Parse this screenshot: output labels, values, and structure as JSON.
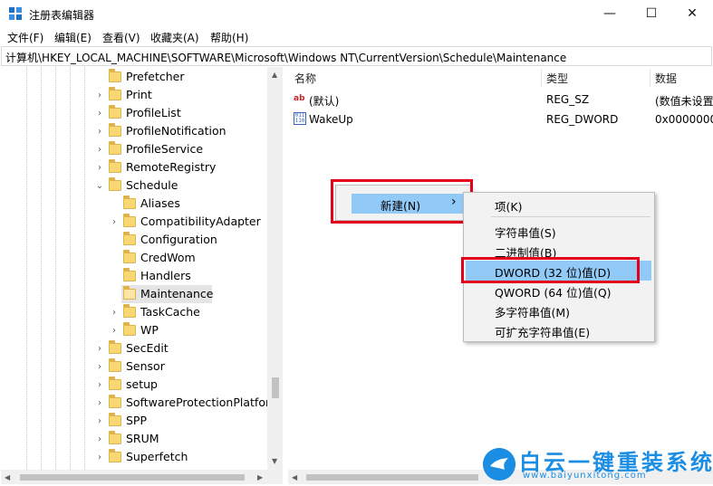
{
  "window": {
    "title": "注册表编辑器",
    "minimize": "—",
    "maximize": "☐",
    "close": "✕"
  },
  "menu": [
    {
      "label": "文件(F)"
    },
    {
      "label": "编辑(E)"
    },
    {
      "label": "查看(V)"
    },
    {
      "label": "收藏夹(A)"
    },
    {
      "label": "帮助(H)"
    }
  ],
  "address": "计算机\\HKEY_LOCAL_MACHINE\\SOFTWARE\\Microsoft\\Windows NT\\CurrentVersion\\Schedule\\Maintenance",
  "tree": {
    "items": [
      {
        "label": "Prefetcher",
        "expander": "",
        "selected": false
      },
      {
        "label": "Print",
        "expander": "›",
        "selected": false
      },
      {
        "label": "ProfileList",
        "expander": "›",
        "selected": false
      },
      {
        "label": "ProfileNotification",
        "expander": "›",
        "selected": false
      },
      {
        "label": "ProfileService",
        "expander": "›",
        "selected": false
      },
      {
        "label": "RemoteRegistry",
        "expander": "›",
        "selected": false
      },
      {
        "label": "Schedule",
        "expander": "⌄",
        "selected": false
      },
      {
        "label": "Aliases",
        "expander": "",
        "selected": false
      },
      {
        "label": "CompatibilityAdapter",
        "expander": "›",
        "selected": false
      },
      {
        "label": "Configuration",
        "expander": "",
        "selected": false
      },
      {
        "label": "CredWom",
        "expander": "",
        "selected": false
      },
      {
        "label": "Handlers",
        "expander": "",
        "selected": false
      },
      {
        "label": "Maintenance",
        "expander": "",
        "selected": true
      },
      {
        "label": "TaskCache",
        "expander": "›",
        "selected": false
      },
      {
        "label": "WP",
        "expander": "›",
        "selected": false
      },
      {
        "label": "SecEdit",
        "expander": "›",
        "selected": false
      },
      {
        "label": "Sensor",
        "expander": "›",
        "selected": false
      },
      {
        "label": "setup",
        "expander": "›",
        "selected": false
      },
      {
        "label": "SoftwareProtectionPlatform",
        "expander": "›",
        "selected": false
      },
      {
        "label": "SPP",
        "expander": "›",
        "selected": false
      },
      {
        "label": "SRUM",
        "expander": "›",
        "selected": false
      },
      {
        "label": "Superfetch",
        "expander": "›",
        "selected": false
      }
    ]
  },
  "list": {
    "columns": {
      "name": "名称",
      "type": "类型",
      "data": "数据"
    },
    "rows": [
      {
        "icon": "string-value-icon",
        "icon_text": "ab",
        "name": "(默认)",
        "type": "REG_SZ",
        "data": "(数值未设置"
      },
      {
        "icon": "binary-value-icon",
        "icon_text": "011 110",
        "name": "WakeUp",
        "type": "REG_DWORD",
        "data": "0x0000000"
      }
    ]
  },
  "context_menu": {
    "new_item": "新建(N)",
    "new_arrow": "›",
    "submenu": {
      "key": "项(K)",
      "string": "字符串值(S)",
      "binary": "二进制值(B)",
      "dword": "DWORD (32 位)值(D)",
      "qword": "QWORD (64 位)值(Q)",
      "multi": "多字符串值(M)",
      "expand": "可扩充字符串值(E)"
    }
  },
  "watermark": {
    "brand": "白云一键重装系统",
    "url": "www.baiyunxitong.com"
  },
  "colors": {
    "highlight": "#91c9f7",
    "selection": "#e5e5e5",
    "red_box": "#e3001b",
    "brand": "#1b8ee4"
  }
}
